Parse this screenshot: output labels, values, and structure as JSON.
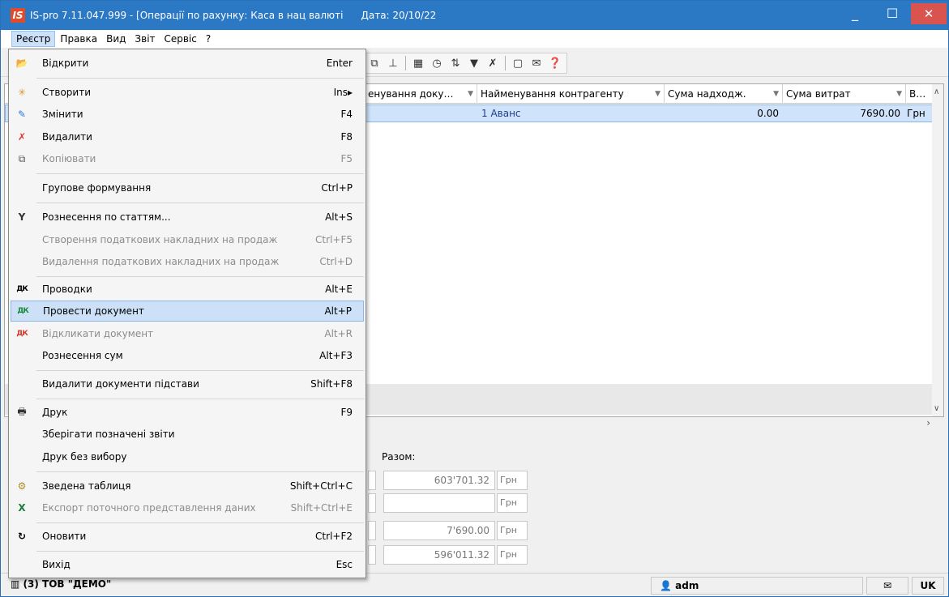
{
  "window": {
    "app_badge": "IS",
    "title": "IS-pro 7.11.047.999 - [Операції по рахунку: Каса в нац валюті",
    "date": "Дата: 20/10/22",
    "min": "_",
    "max": "☐",
    "close": "✕"
  },
  "menubar": [
    "Реєстр",
    "Правка",
    "Вид",
    "Звіт",
    "Сервіс",
    "?"
  ],
  "grid": {
    "headers": [
      "енування доку…",
      "Найменування контрагенту",
      "Сума надходж.",
      "Сума витрат",
      "В…"
    ],
    "row": {
      "doc": "",
      "contractor": "1 Аванс",
      "income": "0.00",
      "expense": "7690.00",
      "currency": "Грн"
    }
  },
  "totals": {
    "label": "Разом:",
    "rows": [
      {
        "value": "603'701.32",
        "currency": "Грн"
      },
      {
        "value": "",
        "currency": "Грн"
      },
      {
        "value": "7'690.00",
        "currency": "Грн"
      },
      {
        "value": "596'011.32",
        "currency": "Грн"
      }
    ]
  },
  "statusbar": {
    "org": "(3) ТОВ \"ДЕМО\"",
    "user": "adm",
    "lang": "UK"
  },
  "dropdown": {
    "items": [
      {
        "label": "Відкрити",
        "shortcut": "Enter",
        "icon": "open-icon",
        "enabled": true
      },
      {
        "label": "Створити",
        "shortcut": "Ins",
        "icon": "create-icon",
        "enabled": true
      },
      {
        "label": "Змінити",
        "shortcut": "F4",
        "icon": "edit-icon",
        "enabled": true
      },
      {
        "label": "Видалити",
        "shortcut": "F8",
        "icon": "delete-icon",
        "enabled": true
      },
      {
        "label": "Копіювати",
        "shortcut": "F5",
        "icon": "copy-icon",
        "enabled": false
      },
      {
        "label": "Групове формування",
        "shortcut": "Ctrl+P",
        "icon": "",
        "enabled": true
      },
      {
        "label": "Рознесення по статтям...",
        "shortcut": "Alt+S",
        "icon": "split-icon",
        "enabled": true
      },
      {
        "label": "Створення податкових накладних на продаж",
        "shortcut": "Ctrl+F5",
        "icon": "",
        "enabled": false
      },
      {
        "label": "Видалення податкових накладних на продаж",
        "shortcut": "Ctrl+D",
        "icon": "",
        "enabled": false
      },
      {
        "label": "Проводки",
        "shortcut": "Alt+E",
        "icon": "dk-icon",
        "enabled": true
      },
      {
        "label": "Провести документ",
        "shortcut": "Alt+P",
        "icon": "dk-post-icon",
        "enabled": true
      },
      {
        "label": "Відкликати документ",
        "shortcut": "Alt+R",
        "icon": "dk-revoke-icon",
        "enabled": false
      },
      {
        "label": "Рознесення сум",
        "shortcut": "Alt+F3",
        "icon": "",
        "enabled": true
      },
      {
        "label": "Видалити документи підстави",
        "shortcut": "Shift+F8",
        "icon": "",
        "enabled": true
      },
      {
        "label": "Друк",
        "shortcut": "F9",
        "icon": "print-icon",
        "enabled": true
      },
      {
        "label": "Зберігати позначені звіти",
        "shortcut": "",
        "icon": "",
        "enabled": true
      },
      {
        "label": "Друк без вибору",
        "shortcut": "",
        "icon": "",
        "enabled": true
      },
      {
        "label": "Зведена таблиця",
        "shortcut": "Shift+Ctrl+C",
        "icon": "pivot-icon",
        "enabled": true
      },
      {
        "label": "Експорт поточного представлення даних",
        "shortcut": "Shift+Ctrl+E",
        "icon": "excel-icon",
        "enabled": false
      },
      {
        "label": "Оновити",
        "shortcut": "Ctrl+F2",
        "icon": "refresh-icon",
        "enabled": true
      },
      {
        "label": "Вихід",
        "shortcut": "Esc",
        "icon": "",
        "enabled": true
      }
    ]
  }
}
